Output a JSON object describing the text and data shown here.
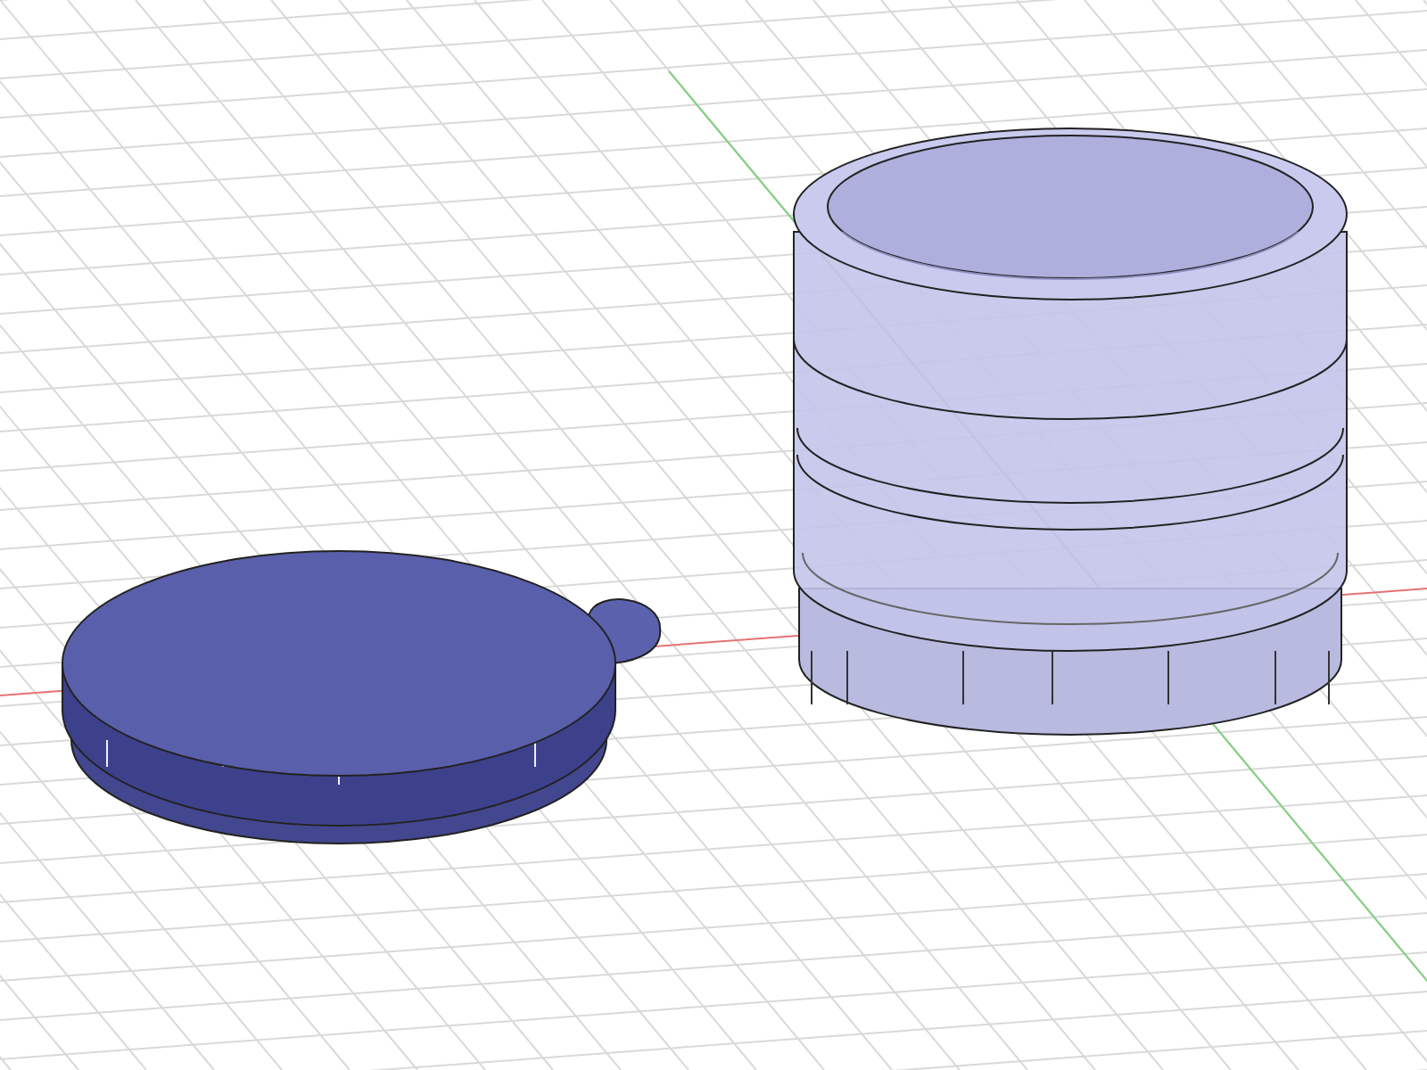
{
  "objects": [
    {
      "kind": "lid"
    },
    {
      "kind": "container"
    }
  ]
}
